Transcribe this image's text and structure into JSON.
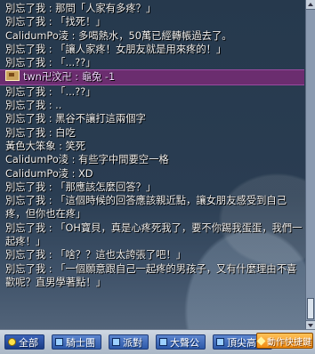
{
  "chat": {
    "lines": [
      {
        "type": "normal",
        "text": "別忘了我 : 那問「人家有多疼？」"
      },
      {
        "type": "normal",
        "text": "別忘了我 : 「找死！」"
      },
      {
        "type": "normal",
        "text": "CalidumPo淩 : 多喝熱水，50萬已經轉帳過去了。"
      },
      {
        "type": "normal",
        "text": "別忘了我 : 「讓人家疼！女朋友就是用來疼的！」"
      },
      {
        "type": "normal",
        "text": "別忘了我 : 「...??」"
      },
      {
        "type": "whisper",
        "text": "twn卍汶卍 : 龜兔 -1"
      },
      {
        "type": "normal",
        "text": "別忘了我 : 「...??」"
      },
      {
        "type": "normal",
        "text": "別忘了我 : .."
      },
      {
        "type": "normal",
        "text": "別忘了我 : 黑谷不讓打這兩個字"
      },
      {
        "type": "normal",
        "text": "別忘了我 : 白吃"
      },
      {
        "type": "normal",
        "text": "黃色大笨象 : 笑死"
      },
      {
        "type": "normal",
        "text": "CalidumPo淩 : 有些字中間要空一格"
      },
      {
        "type": "normal",
        "text": "CalidumPo淩 : XD"
      },
      {
        "type": "normal",
        "text": "別忘了我 : 「那應該怎麼回答？」"
      },
      {
        "type": "normal",
        "text": "別忘了我 : 「這個時候的回答應該親近點，讓女朋友感受到自己疼，但你也在疼」"
      },
      {
        "type": "normal",
        "text": "別忘了我 : 「OH寶貝，真是心疼死我了，要不你踢我蛋蛋，我們一起疼！」"
      },
      {
        "type": "normal",
        "text": "別忘了我 : 「啥？？這也太誇張了吧！」"
      },
      {
        "type": "normal",
        "text": "別忘了我 : 「一個願意跟自己一起疼的男孩子，又有什麼理由不喜歡呢？直男學著點！」"
      }
    ]
  },
  "tabs": [
    {
      "label": "全部",
      "active": true
    },
    {
      "label": "騎士團",
      "active": false
    },
    {
      "label": "派對",
      "active": false
    },
    {
      "label": "大聲公",
      "active": false
    },
    {
      "label": "頂尖高手",
      "active": false
    }
  ],
  "action_key": {
    "label": "動作快捷鍵"
  },
  "colors": {
    "whisper_bg": "#6b2d6f",
    "tab_blue": "#2c58a8",
    "action_orange": "#f08a10"
  }
}
